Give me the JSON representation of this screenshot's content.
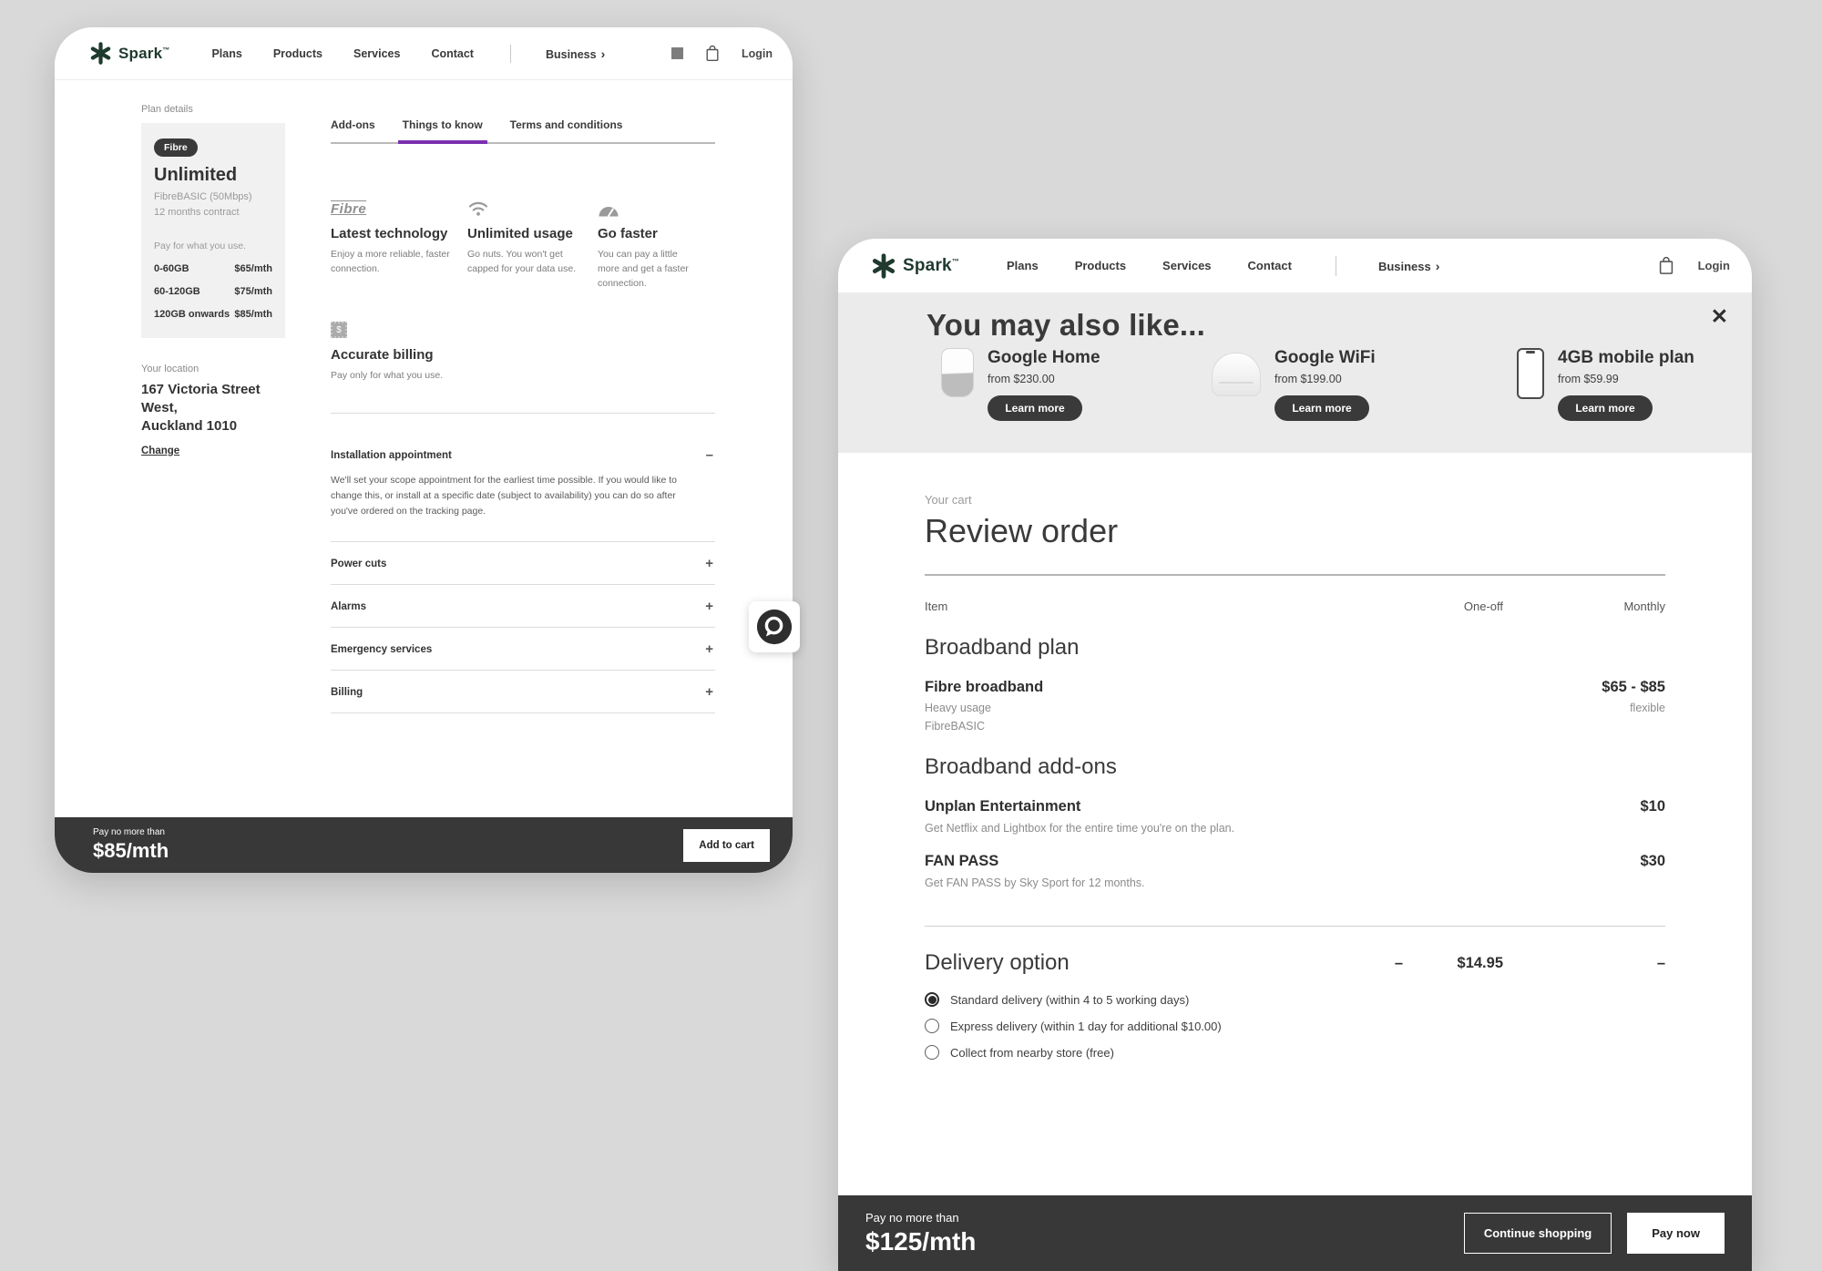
{
  "colors": {
    "accent_purple": "#7a30b0",
    "dark_bar": "#383838",
    "spark_green": "#1f3a2e",
    "upsell_bg": "#ebebeb"
  },
  "left": {
    "header": {
      "logo": "Spark",
      "trademark": "™",
      "nav": [
        "Plans",
        "Products",
        "Services",
        "Contact"
      ],
      "business": "Business",
      "business_chevron": "›",
      "login": "Login"
    },
    "plan": {
      "label": "Plan details",
      "badge": "Fibre",
      "name": "Unlimited",
      "tech": "FibreBASIC (50Mbps)",
      "contract": "12 months contract",
      "usage_label": "Pay for what you use.",
      "tiers": [
        {
          "range": "0-60GB",
          "price": "$65/mth"
        },
        {
          "range": "60-120GB",
          "price": "$75/mth"
        },
        {
          "range": "120GB onwards",
          "price": "$85/mth"
        }
      ]
    },
    "location": {
      "label": "Your location",
      "address_line1": "167 Victoria Street West,",
      "address_line2": "Auckland 1010",
      "change": "Change"
    },
    "tabs": [
      {
        "label": "Add-ons"
      },
      {
        "label": "Things to know"
      },
      {
        "label": "Terms and conditions"
      }
    ],
    "features": [
      {
        "icon": "fibre-logo",
        "logo_text": "Fibre",
        "title": "Latest technology",
        "desc": "Enjoy a more reliable, faster connection."
      },
      {
        "icon": "wifi",
        "title": "Unlimited usage",
        "desc": "Go nuts. You won't get capped for your data use."
      },
      {
        "icon": "speedometer",
        "title": "Go faster",
        "desc": "You can pay a little more and get a faster connection."
      },
      {
        "icon": "billing",
        "icon_glyph": "$",
        "title": "Accurate billing",
        "desc": "Pay only for what you use."
      }
    ],
    "accordion": {
      "expanded": {
        "title": "Installation appointment",
        "toggle": "–",
        "body": "We'll set your scope appointment for the earliest time possible. If you would like to change this, or install at a specific date (subject to availability) you can do so after you've ordered on the tracking page."
      },
      "items": [
        {
          "title": "Power cuts",
          "toggle": "+"
        },
        {
          "title": "Alarms",
          "toggle": "+"
        },
        {
          "title": "Emergency services",
          "toggle": "+"
        },
        {
          "title": "Billing",
          "toggle": "+"
        }
      ]
    },
    "footer": {
      "label": "Pay no more than",
      "price": "$85/mth",
      "cta": "Add to cart"
    }
  },
  "right": {
    "header": {
      "logo": "Spark",
      "trademark": "™",
      "nav": [
        "Plans",
        "Products",
        "Services",
        "Contact"
      ],
      "business": "Business",
      "business_chevron": "›",
      "login": "Login"
    },
    "upsell": {
      "title": "You may also like...",
      "close": "✕",
      "products": [
        {
          "name": "Google Home",
          "price": "from $230.00",
          "cta": "Learn more"
        },
        {
          "name": "Google WiFi",
          "price": "from $199.00",
          "cta": "Learn more"
        },
        {
          "name": "4GB mobile plan",
          "price": "from $59.99",
          "cta": "Learn more"
        }
      ]
    },
    "cart": {
      "eyebrow": "Your cart",
      "title": "Review order",
      "col_item": "Item",
      "col_oneoff": "One-off",
      "col_monthly": "Monthly",
      "plan_section": {
        "heading": "Broadband plan",
        "item": "Fibre broadband",
        "monthly": "$65 - $85",
        "sub1_left": "Heavy usage",
        "sub1_right": "flexible",
        "sub2_left": "FibreBASIC"
      },
      "addons_section": {
        "heading": "Broadband add-ons",
        "items": [
          {
            "name": "Unplan Entertainment",
            "monthly": "$10",
            "desc": "Get Netflix and Lightbox for the entire time you're on the plan."
          },
          {
            "name": "FAN PASS",
            "monthly": "$30",
            "desc": "Get FAN PASS by Sky Sport for 12 months."
          }
        ]
      },
      "delivery": {
        "heading": "Delivery option",
        "oneoff_dash": "–",
        "oneoff_price": "$14.95",
        "monthly_dash": "–",
        "options": [
          {
            "label": "Standard delivery (within 4 to 5 working days)",
            "selected": true
          },
          {
            "label": "Express delivery (within 1 day for additional $10.00)",
            "selected": false
          },
          {
            "label": "Collect from nearby store (free)",
            "selected": false
          }
        ]
      }
    },
    "footer": {
      "label": "Pay no more than",
      "price": "$125/mth",
      "continue_cta": "Continue shopping",
      "pay_cta": "Pay now"
    }
  }
}
